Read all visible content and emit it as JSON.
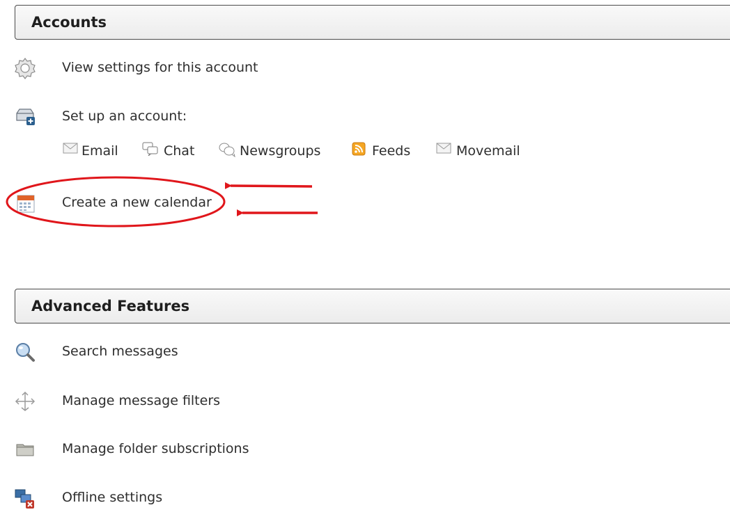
{
  "accounts": {
    "header": "Accounts",
    "view_settings": "View settings for this account",
    "setup": "Set up an account:",
    "types": [
      {
        "label": "Email",
        "icon": "email-icon"
      },
      {
        "label": "Chat",
        "icon": "chat-icon"
      },
      {
        "label": "Newsgroups",
        "icon": "newsgroups-icon"
      },
      {
        "label": "Feeds",
        "icon": "feeds-icon"
      },
      {
        "label": "Movemail",
        "icon": "movemail-icon"
      }
    ],
    "new_calendar": "Create a new calendar"
  },
  "advanced": {
    "header": "Advanced Features",
    "items": [
      {
        "label": "Search messages",
        "icon": "search-icon"
      },
      {
        "label": "Manage message filters",
        "icon": "filters-icon"
      },
      {
        "label": "Manage folder subscriptions",
        "icon": "folder-icon"
      },
      {
        "label": "Offline settings",
        "icon": "offline-icon"
      }
    ]
  },
  "colors": {
    "annotation": "#e0161b",
    "feed_orange": "#f5a623"
  }
}
